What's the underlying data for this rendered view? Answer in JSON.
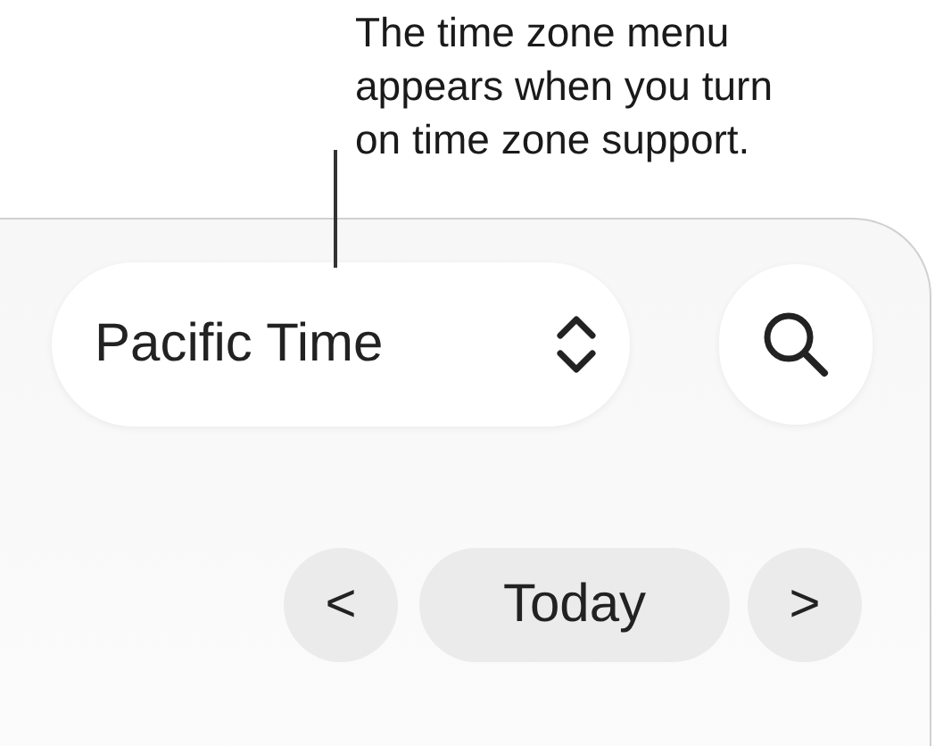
{
  "callout": {
    "lines": [
      "The time zone menu",
      "appears when you turn",
      "on time zone support."
    ]
  },
  "toolbar": {
    "time_zone_menu": {
      "value": "Pacific Time"
    }
  },
  "navigation": {
    "previous": "<",
    "today": "Today",
    "next": ">"
  }
}
